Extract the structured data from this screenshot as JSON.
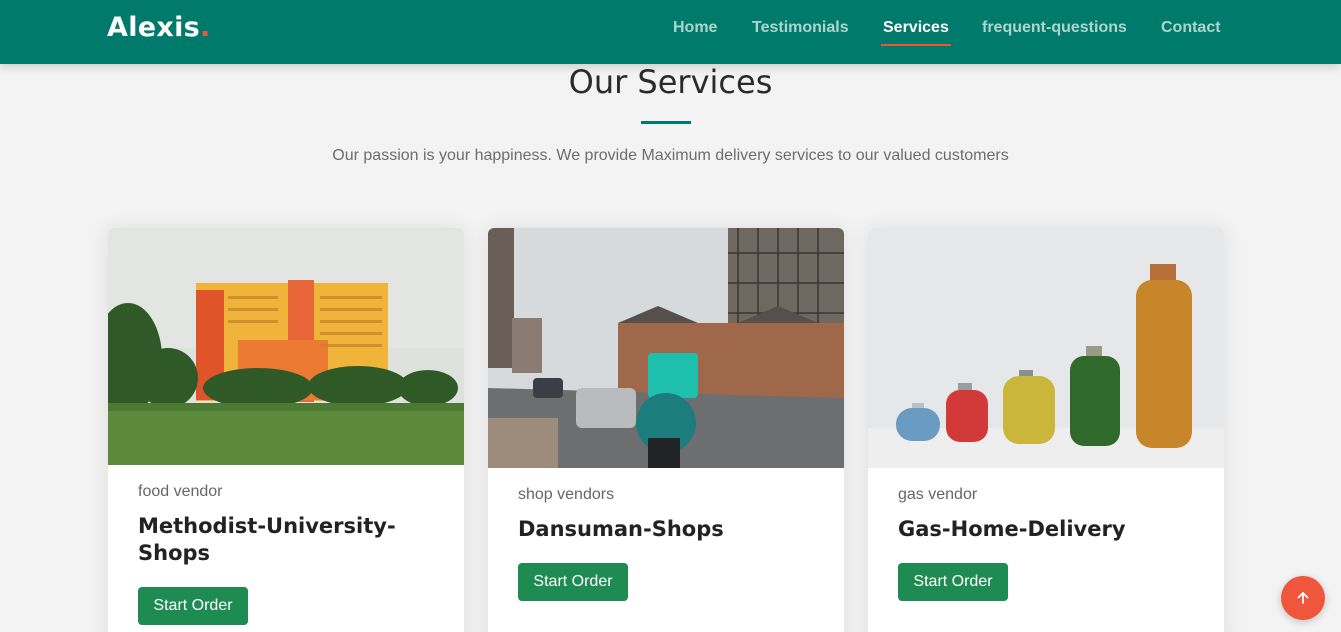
{
  "header": {
    "logo": "Alexis",
    "logo_dot": ".",
    "nav": [
      {
        "label": "Home"
      },
      {
        "label": "Testimonials"
      },
      {
        "label": "Services",
        "active": true
      },
      {
        "label": "frequent-questions"
      },
      {
        "label": "Contact"
      }
    ]
  },
  "services": {
    "title": "Our Services",
    "subtitle": "Our passion is your happiness. We provide Maximum delivery services to our valued customers",
    "cards": [
      {
        "category": "food vendor",
        "title": "Methodist-University-Shops",
        "button": "Start Order",
        "image": "building-on-lawn"
      },
      {
        "category": "shop vendors",
        "title": "Dansuman-Shops",
        "button": "Start Order",
        "image": "delivery-rider-street"
      },
      {
        "category": "gas vendor",
        "title": "Gas-Home-Delivery",
        "button": "Start Order",
        "image": "gas-cylinders"
      }
    ]
  },
  "colors": {
    "brand": "#007a6a",
    "accent": "#f0563c",
    "button": "#1e8c52"
  },
  "icons": {
    "back_to_top": "arrow-up-icon"
  }
}
